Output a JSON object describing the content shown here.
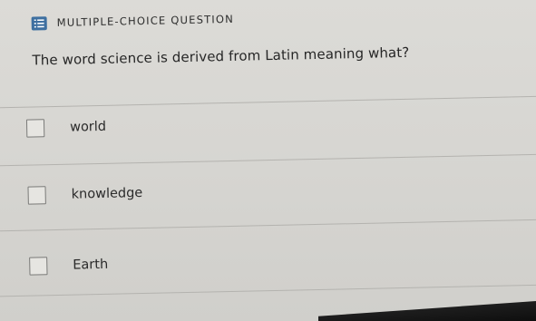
{
  "header": {
    "icon": "list-icon",
    "icon_color": "#3e6fa0",
    "label": "MULTIPLE-CHOICE QUESTION"
  },
  "question": {
    "text": "The word science is derived from Latin meaning what?"
  },
  "options": [
    {
      "label": "world",
      "checked": false
    },
    {
      "label": "knowledge",
      "checked": false
    },
    {
      "label": "Earth",
      "checked": false
    }
  ]
}
